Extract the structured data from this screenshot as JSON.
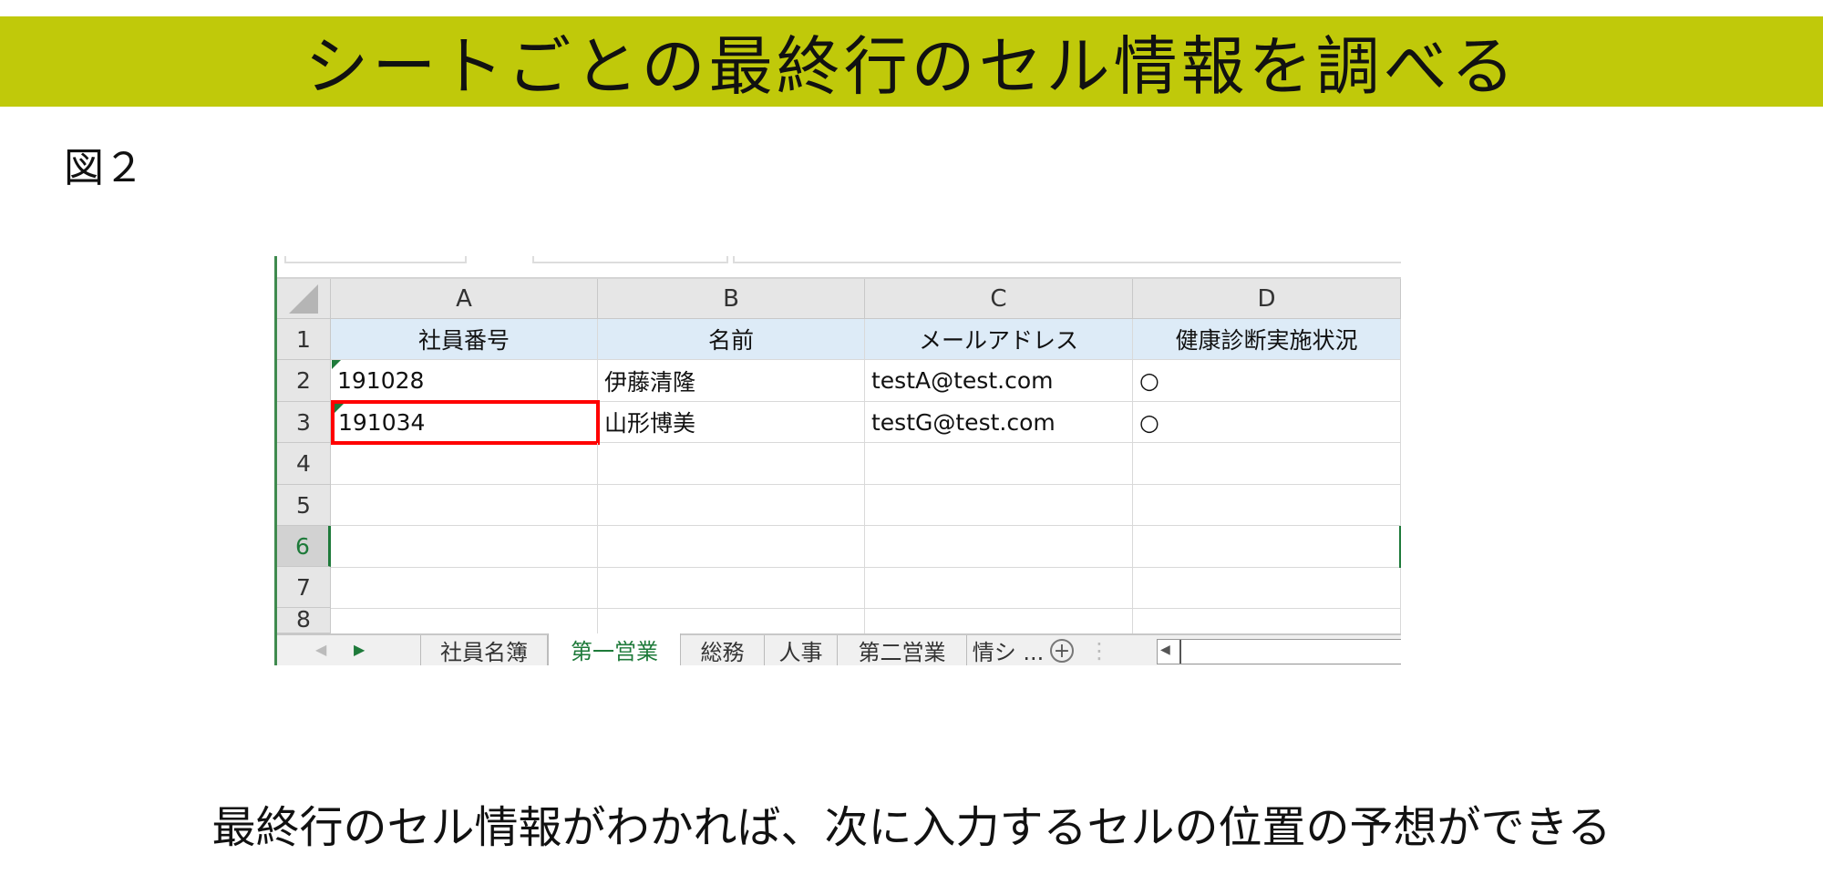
{
  "title": "シートごとの最終行のセル情報を調べる",
  "figure_label": "図２",
  "caption": "最終行のセル情報がわかれば、次に入力するセルの位置の予想ができる",
  "spreadsheet": {
    "columns": [
      "A",
      "B",
      "C",
      "D"
    ],
    "row_numbers": [
      "1",
      "2",
      "3",
      "4",
      "5",
      "6",
      "7",
      "8"
    ],
    "header": [
      "社員番号",
      "名前",
      "メールアドレス",
      "健康診断実施状況"
    ],
    "rows": [
      [
        "191028",
        "伊藤清隆",
        "testA@test.com",
        "○"
      ],
      [
        "191034",
        "山形博美",
        "testG@test.com",
        "○"
      ]
    ],
    "selected_cell": "A3",
    "sheet_tabs": [
      "社員名簿",
      "第一営業",
      "総務",
      "人事",
      "第二営業",
      "情シ ..."
    ],
    "active_tab": "第一営業",
    "add_sheet": "+"
  },
  "colors": {
    "banner": "#c0c90a",
    "selection": "#ff0000",
    "header_fill": "#ddebf7",
    "active_tab": "#1e7a3a"
  }
}
